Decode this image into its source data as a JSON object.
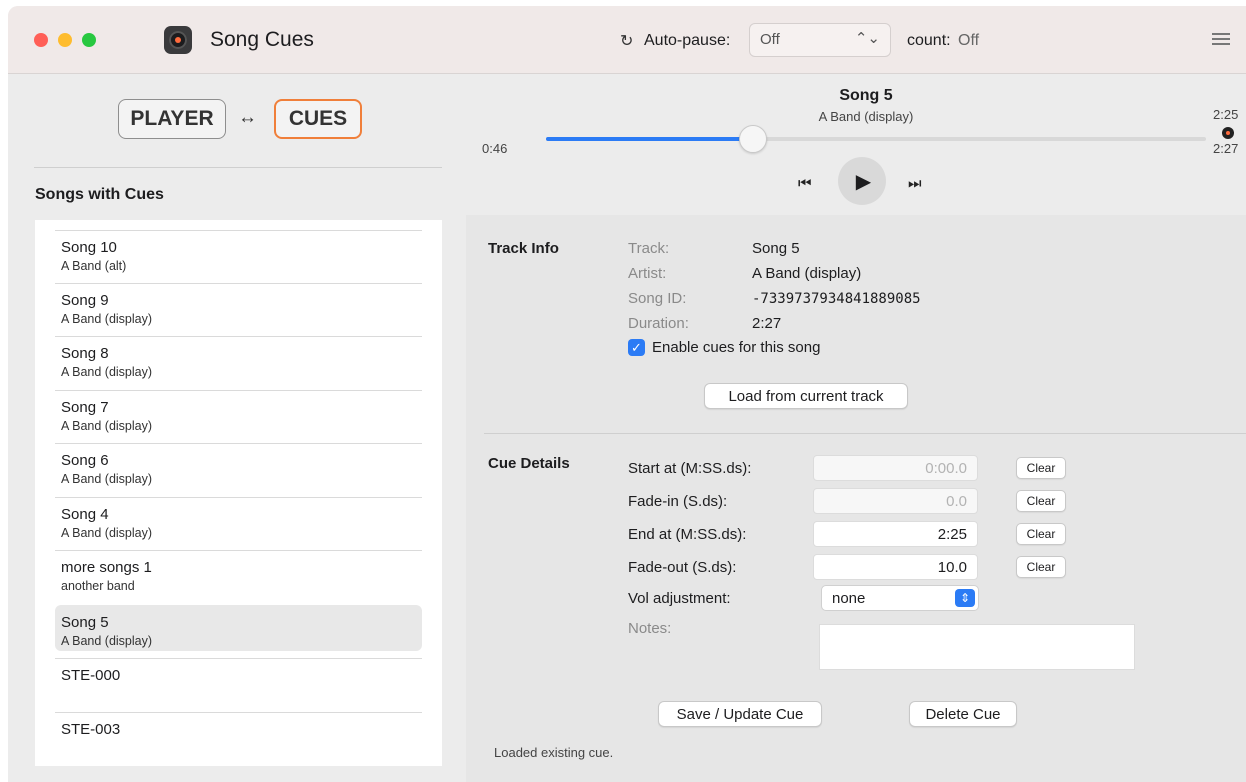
{
  "window": {
    "app_title": "Song Cues"
  },
  "toolbar": {
    "autopause_icon": "refresh-icon",
    "autopause_label": "Auto-pause:",
    "autopause_value": "Off",
    "count_label": "count:",
    "count_value": "Off",
    "menu_icon": "hamburger-menu-icon"
  },
  "mode": {
    "player_label": "PLAYER",
    "swap_symbol": "↔",
    "cues_label": "CUES",
    "active": "CUES",
    "active_color": "#f07f3a"
  },
  "songs_panel": {
    "title": "Songs with Cues",
    "items": [
      {
        "title": "Song 10",
        "artist": "A Band (alt)"
      },
      {
        "title": "Song 9",
        "artist": "A Band (display)"
      },
      {
        "title": "Song 8",
        "artist": "A Band (display)"
      },
      {
        "title": "Song 7",
        "artist": "A Band (display)"
      },
      {
        "title": "Song 6",
        "artist": "A Band (display)"
      },
      {
        "title": "Song 4",
        "artist": "A Band (display)"
      },
      {
        "title": "more songs 1",
        "artist": "another band"
      },
      {
        "title": "Song 5",
        "artist": "A Band (display)",
        "selected": true
      },
      {
        "title": "STE-000",
        "artist": ""
      },
      {
        "title": "STE-003",
        "artist": ""
      }
    ]
  },
  "now_playing": {
    "title": "Song 5",
    "artist": "A Band (display)",
    "elapsed": "0:46",
    "cue_end": "2:25",
    "total": "2:27",
    "progress_fraction": 0.313,
    "accent": "#2b7bf5",
    "controls": {
      "prev_icon": "skip-back-icon",
      "play_icon": "play-icon",
      "next_icon": "skip-forward-icon"
    }
  },
  "track_info": {
    "heading": "Track Info",
    "track_label": "Track:",
    "track_value": "Song 5",
    "artist_label": "Artist:",
    "artist_value": "A Band (display)",
    "song_id_label": "Song ID:",
    "song_id_value": "-7339737934841889085",
    "duration_label": "Duration:",
    "duration_value": "2:27",
    "enable_label": "Enable cues for this song",
    "enable_checked": true,
    "load_button": "Load from current track"
  },
  "cue_details": {
    "heading": "Cue Details",
    "start_label": "Start at (M:SS.ds):",
    "start_placeholder": "0:00.0",
    "start_value": "",
    "fadein_label": "Fade-in (S.ds):",
    "fadein_placeholder": "0.0",
    "fadein_value": "",
    "end_label": "End at (M:SS.ds):",
    "end_value": "2:25",
    "fadeout_label": "Fade-out (S.ds):",
    "fadeout_value": "10.0",
    "clear_label": "Clear",
    "vol_label": "Vol adjustment:",
    "vol_value": "none",
    "notes_label": "Notes:",
    "notes_value": "",
    "save_button": "Save / Update Cue",
    "delete_button": "Delete Cue",
    "status": "Loaded existing cue."
  }
}
